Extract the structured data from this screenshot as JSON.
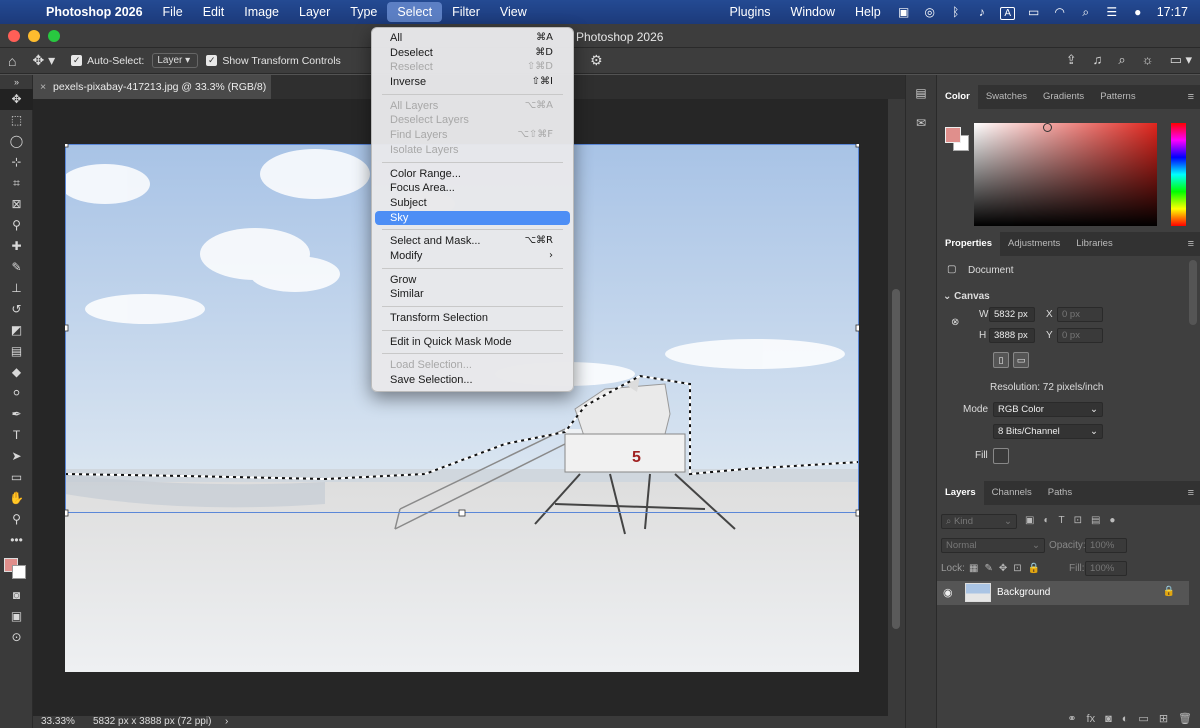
{
  "menubar": {
    "app_name": "Photoshop 2026",
    "items": [
      "File",
      "Edit",
      "Image",
      "Layer",
      "Type",
      "Select",
      "Filter",
      "View"
    ],
    "right_items": [
      "Plugins",
      "Window",
      "Help"
    ],
    "clock": "17:17",
    "input_source": "A"
  },
  "window": {
    "title": "Photoshop 2026"
  },
  "options_bar": {
    "auto_select_label": "Auto-Select:",
    "auto_select_target": "Layer",
    "transform_controls_label": "Show Transform Controls"
  },
  "document_tab": {
    "title": "pexels-pixabay-417213.jpg @ 33.3% (RGB/8)"
  },
  "status_bar": {
    "zoom": "33.33%",
    "doc_info": "5832 px x 3888 px (72 ppi)"
  },
  "select_menu": {
    "items": [
      {
        "label": "All",
        "shortcut": "⌘A",
        "disabled": false
      },
      {
        "label": "Deselect",
        "shortcut": "⌘D",
        "disabled": false
      },
      {
        "label": "Reselect",
        "shortcut": "⇧⌘D",
        "disabled": true
      },
      {
        "label": "Inverse",
        "shortcut": "⇧⌘I",
        "disabled": false
      },
      {
        "sep": true
      },
      {
        "label": "All Layers",
        "shortcut": "⌥⌘A",
        "disabled": true
      },
      {
        "label": "Deselect Layers",
        "shortcut": "",
        "disabled": true
      },
      {
        "label": "Find Layers",
        "shortcut": "⌥⇧⌘F",
        "disabled": true
      },
      {
        "label": "Isolate Layers",
        "shortcut": "",
        "disabled": true
      },
      {
        "sep": true
      },
      {
        "label": "Color Range...",
        "shortcut": "",
        "disabled": false
      },
      {
        "label": "Focus Area...",
        "shortcut": "",
        "disabled": false
      },
      {
        "label": "Subject",
        "shortcut": "",
        "disabled": false
      },
      {
        "label": "Sky",
        "shortcut": "",
        "disabled": false,
        "highlighted": true
      },
      {
        "sep": true
      },
      {
        "label": "Select and Mask...",
        "shortcut": "⌥⌘R",
        "disabled": false
      },
      {
        "label": "Modify",
        "shortcut": "›",
        "disabled": false
      },
      {
        "sep": true
      },
      {
        "label": "Grow",
        "shortcut": "",
        "disabled": false
      },
      {
        "label": "Similar",
        "shortcut": "",
        "disabled": false
      },
      {
        "sep": true
      },
      {
        "label": "Transform Selection",
        "shortcut": "",
        "disabled": false
      },
      {
        "sep": true
      },
      {
        "label": "Edit in Quick Mask Mode",
        "shortcut": "",
        "disabled": false
      },
      {
        "sep": true
      },
      {
        "label": "Load Selection...",
        "shortcut": "",
        "disabled": true
      },
      {
        "label": "Save Selection...",
        "shortcut": "",
        "disabled": false
      }
    ]
  },
  "color_panel": {
    "tabs": [
      "Color",
      "Swatches",
      "Gradients",
      "Patterns"
    ],
    "foreground": "#e08f8c",
    "background": "#ffffff"
  },
  "properties_panel": {
    "tabs": [
      "Properties",
      "Adjustments",
      "Libraries"
    ],
    "type_label": "Document",
    "section": "Canvas",
    "w_label": "W",
    "w_value": "5832 px",
    "h_label": "H",
    "h_value": "3888 px",
    "x_label": "X",
    "x_value": "0 px",
    "y_label": "Y",
    "y_value": "0 px",
    "resolution": "Resolution: 72 pixels/inch",
    "mode_label": "Mode",
    "mode_value": "RGB Color",
    "bits_value": "8 Bits/Channel",
    "fill_label": "Fill"
  },
  "layers_panel": {
    "tabs": [
      "Layers",
      "Channels",
      "Paths"
    ],
    "kind_placeholder": "Kind",
    "blend_mode": "Normal",
    "opacity_label": "Opacity:",
    "opacity_value": "100%",
    "lock_label": "Lock:",
    "fill_label": "Fill:",
    "fill_value": "100%",
    "layer_name": "Background"
  },
  "image": {
    "tower_number": "5"
  },
  "colors": {
    "menubar": "#1c3a7a",
    "highlight": "#4d8ef5",
    "accent_swatch": "#e08f8c"
  }
}
